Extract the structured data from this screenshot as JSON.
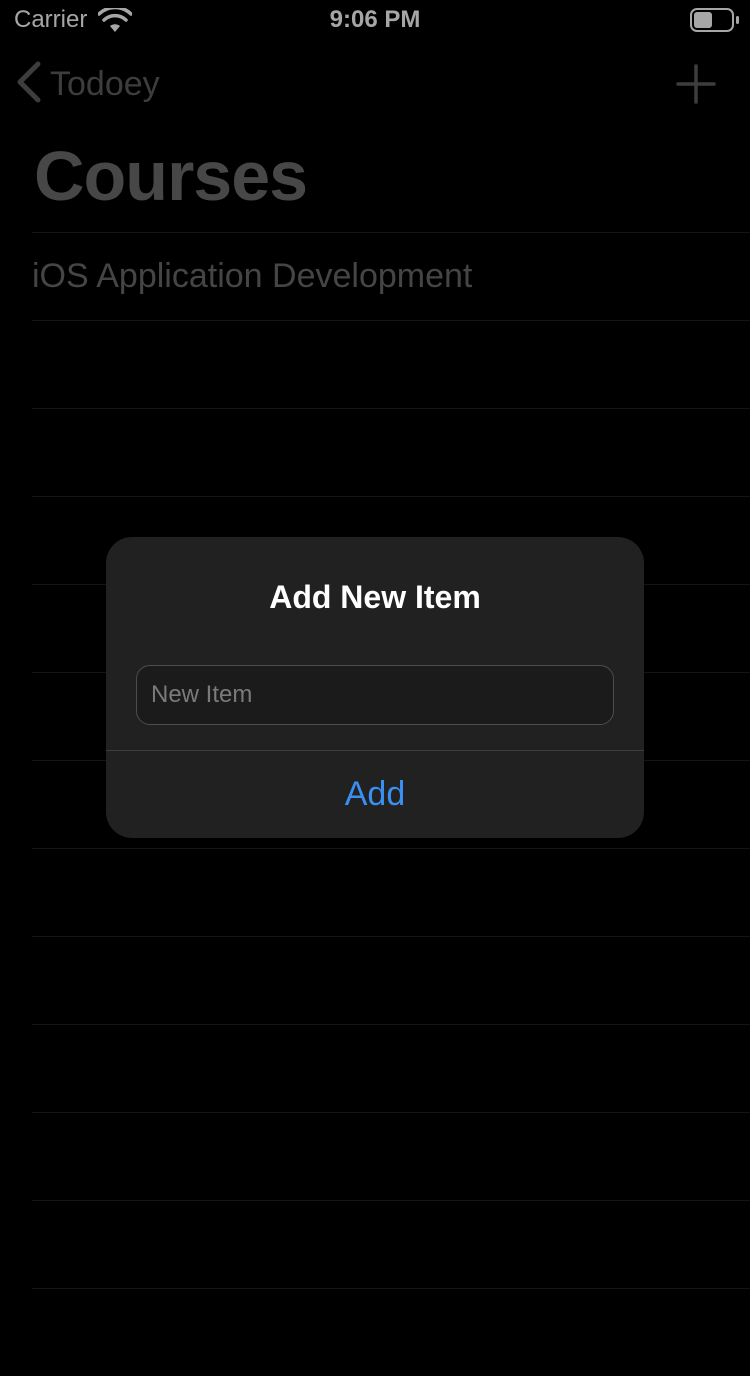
{
  "status_bar": {
    "carrier": "Carrier",
    "time": "9:06 PM"
  },
  "nav": {
    "back_label": "Todoey",
    "title": "Courses"
  },
  "items": [
    "iOS Application Development"
  ],
  "alert": {
    "title": "Add New Item",
    "field_placeholder": "New Item",
    "field_value": "",
    "action_label": "Add"
  },
  "colors": {
    "accent": "#3b8ff2",
    "alert_bg": "#212121",
    "background": "#000000"
  },
  "icons": {
    "back": "chevron-left-icon",
    "add": "plus-icon",
    "wifi": "wifi-icon",
    "battery": "battery-icon"
  }
}
